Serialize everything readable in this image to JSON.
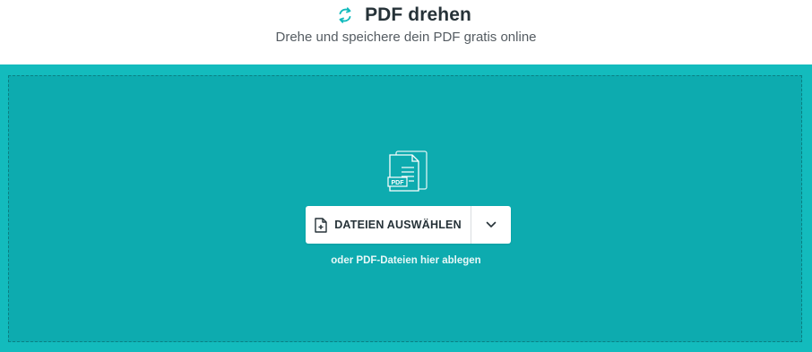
{
  "header": {
    "title": "PDF drehen",
    "subtitle": "Drehe und speichere dein PDF gratis online"
  },
  "dropzone": {
    "file_icon_label": "PDF",
    "choose_button_label": "DATEIEN AUSWÄHLEN",
    "hint": "oder PDF-Dateien hier ablegen"
  },
  "icons": {
    "title_icon": "rotate-icon",
    "file_icon": "pdf-files-icon",
    "choose_icon": "add-file-icon",
    "dropdown_icon": "chevron-down-icon"
  },
  "colors": {
    "accent": "#13bbbd",
    "dropzone": "#0dabaf",
    "title_text": "#263238"
  }
}
